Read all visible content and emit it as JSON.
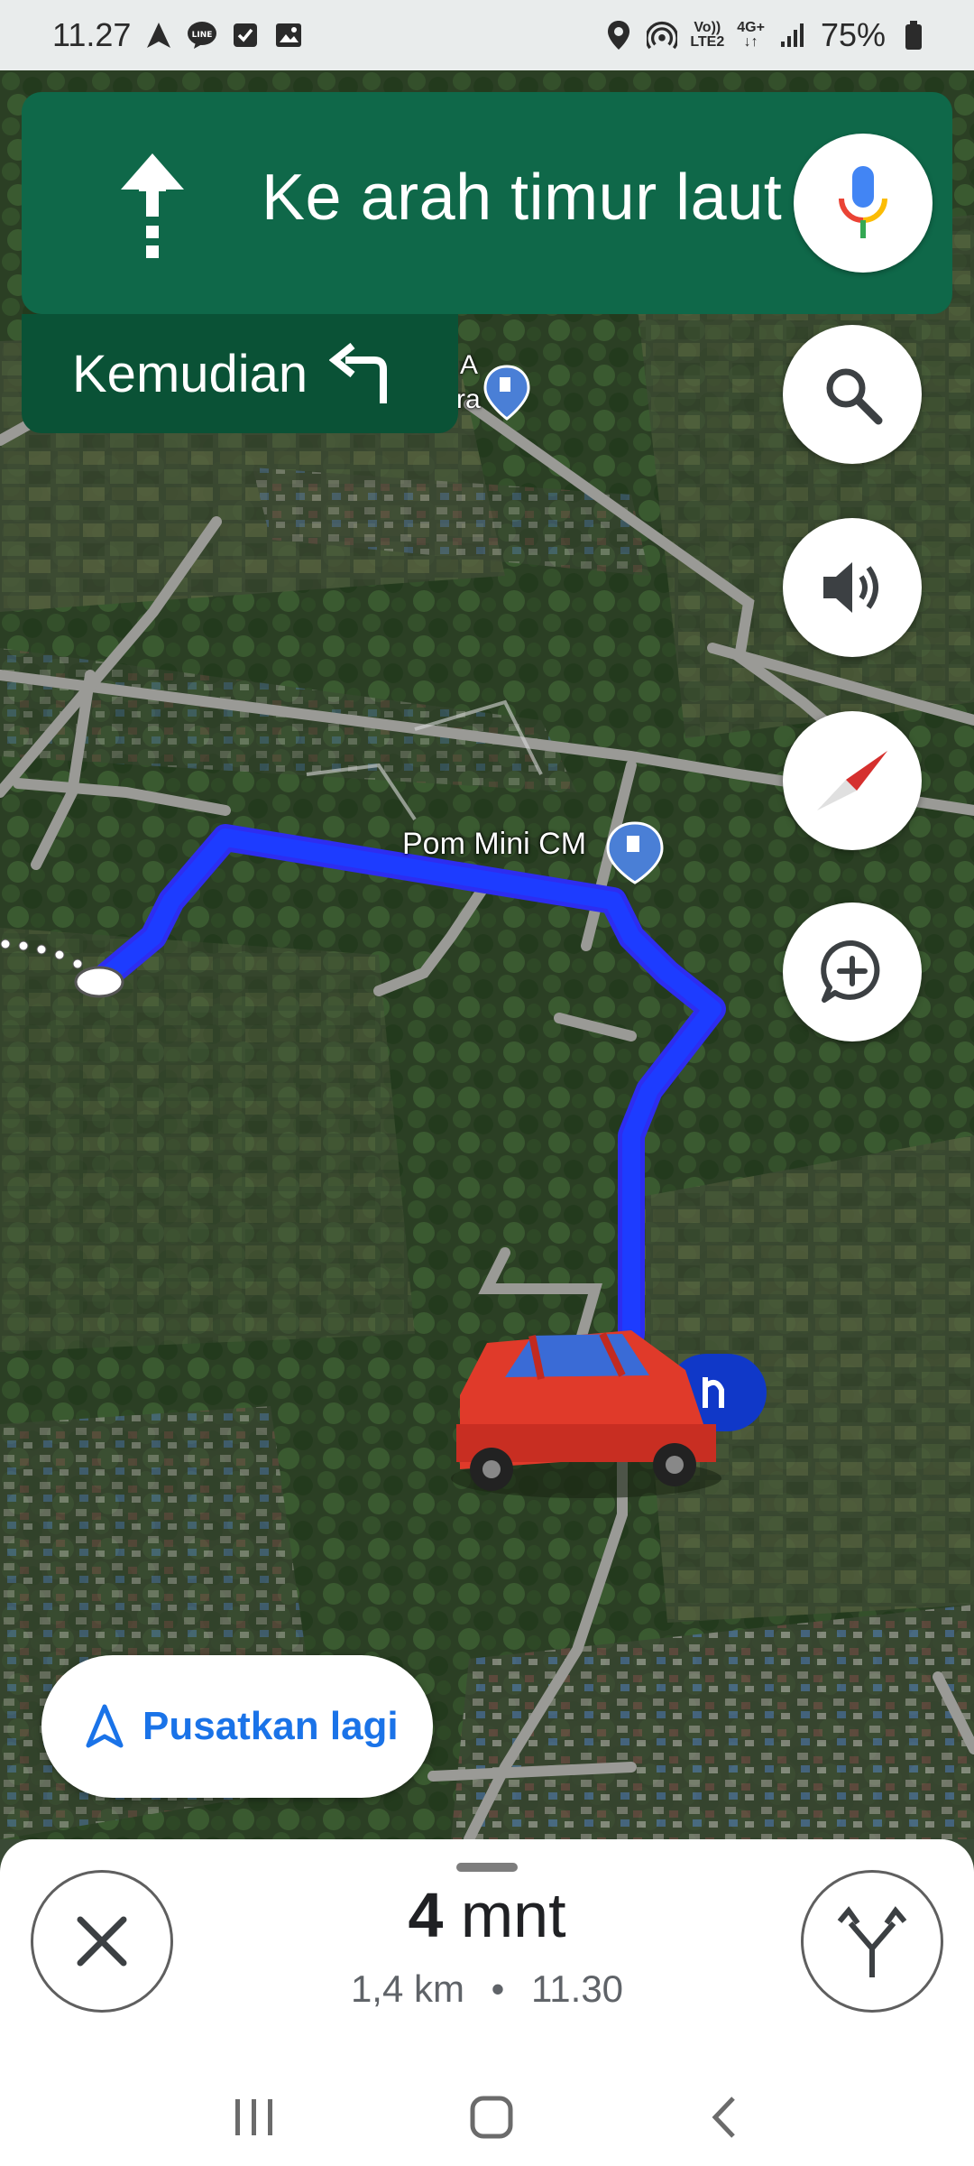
{
  "status_bar": {
    "time": "11.27",
    "volte_top": "Vo))",
    "volte_bottom": "LTE2",
    "network_top": "4G+",
    "network_bottom": "↓↑",
    "battery": "75%"
  },
  "navigation": {
    "instruction": "Ke arah timur laut",
    "then_label": "Kemudian",
    "maneuver_icon": "arrow-up-icon",
    "next_maneuver_icon": "turn-left-icon"
  },
  "map": {
    "poi_fuel": "Pom Mini CM",
    "poi_partial_top": "​A",
    "poi_partial_bottom": "ra"
  },
  "fab": {
    "search": "search-icon",
    "sound": "volume-icon",
    "compass": "compass-icon",
    "report": "add-comment-icon"
  },
  "recenter": {
    "label": "Pusatkan lagi"
  },
  "trip": {
    "duration_value": "4",
    "duration_unit": "mnt",
    "distance": "1,4 km",
    "separator": "•",
    "arrival": "11.30"
  },
  "colors": {
    "nav_green": "#0f6849",
    "nav_green_dark": "#0a5236",
    "route_blue": "#1a40ff",
    "accent_blue": "#1a73e8"
  }
}
